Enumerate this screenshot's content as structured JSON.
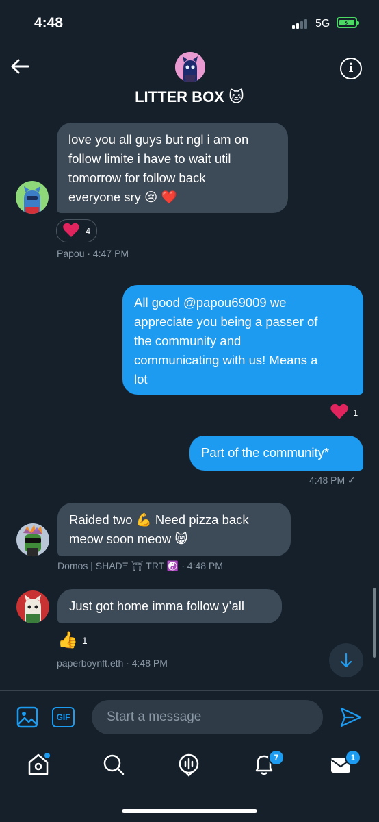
{
  "status_bar": {
    "time": "4:48",
    "network": "5G"
  },
  "header": {
    "title": "LITTER BOX 🐱"
  },
  "messages": [
    {
      "type": "received",
      "text": "love you all guys but ngl i am on follow limite i have to wait util tomorrow for follow back everyone sry 😢 ❤️",
      "lines": [
        "love you all guys but ngl i am on",
        "follow limite i have to wait util",
        "tomorrow for follow back",
        "everyone sry 😢 ❤️"
      ],
      "reaction_emoji": "❤️",
      "reaction_count": "4",
      "sender": "Papou",
      "time": "· 4:47 PM"
    },
    {
      "type": "sent",
      "mention": "@papou69009",
      "lines": [
        "All good",
        "we",
        "appreciate you being a passer of",
        "the community and",
        "communicating with us! Means a",
        "lot"
      ],
      "reaction_emoji": "❤️",
      "reaction_count": "1"
    },
    {
      "type": "sent",
      "text": "Part of the community*",
      "time": "4:48 PM",
      "status_icon": "✓"
    },
    {
      "type": "received",
      "lines": [
        "Raided two 💪 Need pizza back",
        "meow soon meow 😸"
      ],
      "sender": "Domos | SHADΞ ⛩ TRT ☯️",
      "time": "· 4:48 PM"
    },
    {
      "type": "received",
      "text": "Just got home imma follow y’all",
      "reaction_emoji": "👍",
      "reaction_count": "1",
      "sender": "paperboynft.eth",
      "time": "· 4:48 PM"
    }
  ],
  "composer": {
    "gif_label": "GIF",
    "placeholder": "Start a message"
  },
  "tab_bar": {
    "notifications_badge": "7",
    "messages_badge": "1"
  },
  "colors": {
    "background": "#15202b",
    "accent": "#1d9bf0",
    "received_bubble": "#3d4a57",
    "heart": "#e0245e"
  },
  "icons": [
    "back-arrow-icon",
    "info-icon",
    "image-icon",
    "send-icon",
    "arrow-down-icon",
    "home-icon",
    "search-icon",
    "spaces-icon",
    "bell-icon",
    "mail-icon"
  ]
}
